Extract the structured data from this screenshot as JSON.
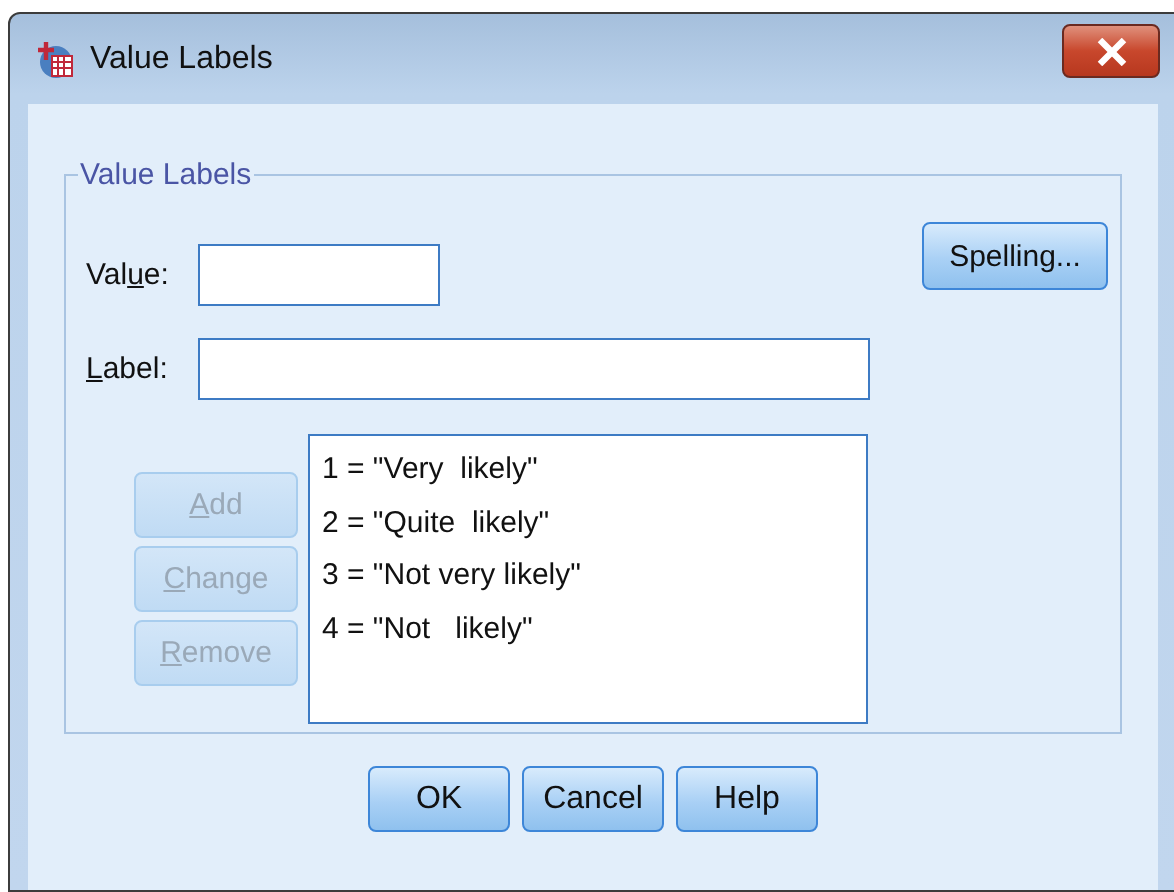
{
  "window": {
    "title": "Value Labels"
  },
  "group": {
    "title": "Value Labels"
  },
  "fields": [
    {
      "kind": "short",
      "label": {
        "before": "Val",
        "underlined": "u",
        "after": "e:"
      }
    },
    {
      "kind": "long",
      "label": {
        "underlined": "L",
        "after": "abel:"
      }
    }
  ],
  "spelling_button": {
    "label": "Spelling..."
  },
  "edit_buttons": [
    {
      "label": {
        "underlined": "A",
        "after": "dd"
      },
      "disabled": true
    },
    {
      "label": {
        "underlined": "C",
        "after": "hange"
      },
      "disabled": true
    },
    {
      "label": {
        "underlined": "R",
        "after": "emove"
      },
      "disabled": true
    }
  ],
  "labels_list": {
    "items": [
      {
        "text": "1 = \"Very  likely\"",
        "selected": false
      },
      {
        "text": "2 = \"Quite  likely\"",
        "selected": false
      },
      {
        "text": "3 = \"Not very likely\"",
        "selected": false
      },
      {
        "text": "4 = \"Not   likely\"",
        "selected": false
      }
    ]
  },
  "buttons": [
    {
      "label": "OK"
    },
    {
      "label": "Cancel"
    },
    {
      "label": "Help"
    }
  ]
}
